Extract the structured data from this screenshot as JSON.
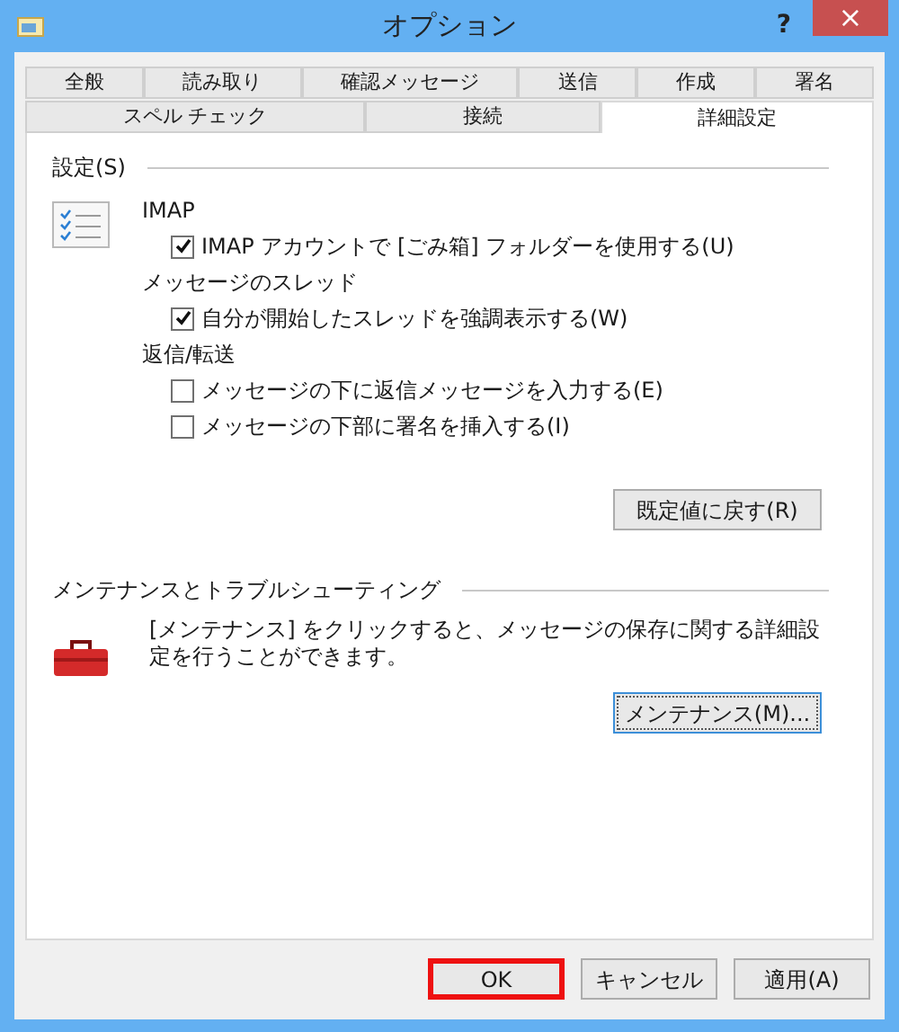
{
  "window": {
    "title": "オプション",
    "help": "?",
    "close": "×"
  },
  "tab_rows": [
    [
      {
        "label": "全般",
        "selected": false
      },
      {
        "label": "読み取り",
        "selected": false
      },
      {
        "label": "確認メッセージ",
        "selected": false
      },
      {
        "label": "送信",
        "selected": false
      },
      {
        "label": "作成",
        "selected": false
      },
      {
        "label": "署名",
        "selected": false
      }
    ],
    [
      {
        "label": "スペル チェック",
        "selected": false
      },
      {
        "label": "接続",
        "selected": false
      },
      {
        "label": "詳細設定",
        "selected": true
      }
    ]
  ],
  "settings": {
    "heading": "設定(S)",
    "groups": [
      {
        "label": "IMAP",
        "options": [
          {
            "label": "IMAP アカウントで [ごみ箱] フォルダーを使用する(U)",
            "checked": true
          }
        ]
      },
      {
        "label": "メッセージのスレッド",
        "options": [
          {
            "label": "自分が開始したスレッドを強調表示する(W)",
            "checked": true
          }
        ]
      },
      {
        "label": "返信/転送",
        "options": [
          {
            "label": "メッセージの下に返信メッセージを入力する(E)",
            "checked": false
          },
          {
            "label": "メッセージの下部に署名を挿入する(I)",
            "checked": false
          }
        ]
      }
    ],
    "reset_button": "既定値に戻す(R)"
  },
  "maintenance": {
    "heading": "メンテナンスとトラブルシューティング",
    "description": "[メンテナンス] をクリックすると、メッセージの保存に関する詳細設定を行うことができます。",
    "button": "メンテナンス(M)..."
  },
  "buttons": [
    {
      "label": "OK",
      "highlighted": true
    },
    {
      "label": "キャンセル",
      "highlighted": false
    },
    {
      "label": "適用(A)",
      "highlighted": false
    }
  ]
}
